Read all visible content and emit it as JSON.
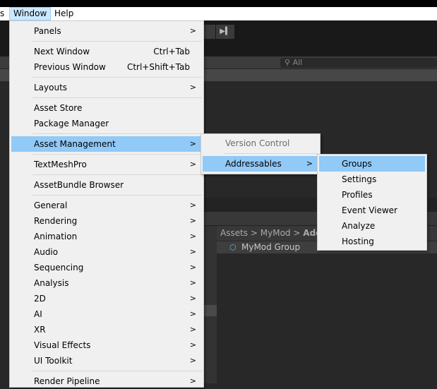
{
  "menubar": {
    "items": [
      "s",
      "Window",
      "Help"
    ]
  },
  "toolbar": {
    "step_icon": "step-forward-icon"
  },
  "hierarchy": {
    "search_placeholder": "All"
  },
  "project": {
    "breadcrumb": [
      "Assets",
      ">",
      "MyMod",
      ">",
      "Add"
    ],
    "group_item": "MyMod Group"
  },
  "window_menu": {
    "items": [
      {
        "label": "Panels",
        "submenu": true
      },
      {
        "label": "Next Window",
        "shortcut": "Ctrl+Tab"
      },
      {
        "label": "Previous Window",
        "shortcut": "Ctrl+Shift+Tab"
      },
      {
        "label": "Layouts",
        "submenu": true
      },
      {
        "label": "Asset Store"
      },
      {
        "label": "Package Manager"
      },
      {
        "label": "Asset Management",
        "submenu": true,
        "highlighted": true
      },
      {
        "label": "TextMeshPro",
        "submenu": true
      },
      {
        "label": "AssetBundle Browser"
      },
      {
        "label": "General",
        "submenu": true
      },
      {
        "label": "Rendering",
        "submenu": true
      },
      {
        "label": "Animation",
        "submenu": true
      },
      {
        "label": "Audio",
        "submenu": true
      },
      {
        "label": "Sequencing",
        "submenu": true
      },
      {
        "label": "Analysis",
        "submenu": true
      },
      {
        "label": "2D",
        "submenu": true
      },
      {
        "label": "AI",
        "submenu": true
      },
      {
        "label": "XR",
        "submenu": true
      },
      {
        "label": "Visual Effects",
        "submenu": true
      },
      {
        "label": "UI Toolkit",
        "submenu": true
      },
      {
        "label": "Render Pipeline",
        "submenu": true
      }
    ]
  },
  "asset_management_menu": {
    "items": [
      {
        "label": "Version Control",
        "disabled": true
      },
      {
        "label": "Addressables",
        "submenu": true,
        "highlighted": true
      }
    ]
  },
  "addressables_menu": {
    "items": [
      {
        "label": "Groups",
        "highlighted": true
      },
      {
        "label": "Settings"
      },
      {
        "label": "Profiles"
      },
      {
        "label": "Event Viewer"
      },
      {
        "label": "Analyze"
      },
      {
        "label": "Hosting"
      }
    ]
  },
  "arrow": ">",
  "colors": {
    "highlight": "#91c9f7",
    "menu_bg": "#f0f0f0",
    "menubar_active": "#cce8ff"
  }
}
